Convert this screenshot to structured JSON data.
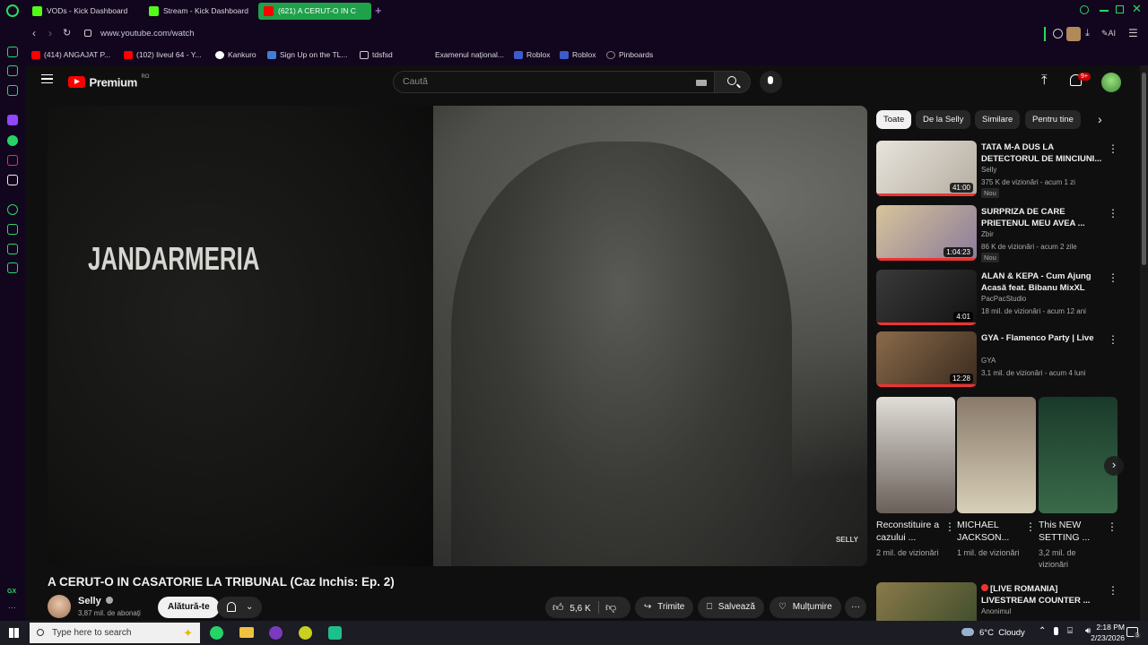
{
  "browser": {
    "tabs": [
      {
        "label": "VODs - Kick Dashboard",
        "color": "#53fc18"
      },
      {
        "label": "Stream - Kick Dashboard",
        "color": "#53fc18"
      },
      {
        "label": "(621) A CERUT-O IN C",
        "color": "#ff0000"
      }
    ],
    "url": "www.youtube.com/watch",
    "ai_label": "AI",
    "bookmarks": [
      {
        "label": "(414) ANGAJAT P...",
        "color": "#ff0000"
      },
      {
        "label": "(102) liveul 64 - Y...",
        "color": "#ff0000"
      },
      {
        "label": "Kankuro",
        "color": "#ffffff"
      },
      {
        "label": "Sign Up on the TL...",
        "color": "#3d7fd6"
      },
      {
        "label": "tdsfsd",
        "color": "#cccccc"
      },
      {
        "label": "Examenul național...",
        "color": "#12061e"
      },
      {
        "label": "Roblox",
        "color": "#3d5ccc"
      },
      {
        "label": "Roblox",
        "color": "#3d5ccc"
      },
      {
        "label": "Pinboards",
        "color": "#888888"
      }
    ],
    "sidebar_gx_label": "GX"
  },
  "youtube": {
    "logo_text": "Premium",
    "logo_region": "RO",
    "search_placeholder": "Caută",
    "notifications_badge": "9+",
    "video": {
      "overlay_text": "JANDARMERIA",
      "watermark": "SELLY",
      "title": "A CERUT-O IN CASATORIE LA TRIBUNAL (Caz Inchis: Ep. 2)"
    },
    "channel": {
      "name": "Selly",
      "subscribers": "3,87 mil. de abonați",
      "join_label": "Alătură-te"
    },
    "actions": {
      "likes": "5,6 K",
      "share": "Trimite",
      "save": "Salvează",
      "thanks": "Mulțumire"
    },
    "chips": [
      "Toate",
      "De la Selly",
      "Similare",
      "Pentru tine"
    ],
    "recommendations": [
      {
        "title": "TATA M-A DUS LA DETECTORUL DE MINCIUNI...",
        "channel": "Selly",
        "meta": "375 K de vizionări - acum 1 zi",
        "badge": "Nou",
        "duration": "41:00",
        "thumb": "#c9c2b8"
      },
      {
        "title": "SURPRIZA DE CARE PRIETENUL MEU AVEA ...",
        "channel": "Zbir",
        "meta": "86 K de vizionări - acum 2 zile",
        "badge": "Nou",
        "duration": "1:04:23",
        "thumb": "#b8a88e"
      },
      {
        "title": "ALAN & KEPA - Cum Ajung Acasă feat. Bibanu MixXL",
        "channel": "PacPacStudio",
        "meta": "18 mil. de vizionări - acum 12 ani",
        "badge": "",
        "duration": "4:01",
        "thumb": "#2a2a2a"
      },
      {
        "title": "GYA - Flamenco Party | Live",
        "channel": "GYA",
        "meta": "3,1 mil. de vizionări - acum 4 luni",
        "badge": "",
        "duration": "12:28",
        "thumb": "#5e4a3a"
      }
    ],
    "shorts": [
      {
        "title": "Reconstituire a cazului ...",
        "views": "2 mil. de vizionări",
        "thumb": "#7a7068"
      },
      {
        "title": "MICHAEL JACKSON...",
        "views": "1 mil. de vizionări",
        "thumb": "#a89a7a"
      },
      {
        "title": "This NEW SETTING ...",
        "views": "3,2 mil. de vizionări",
        "thumb": "#2c4a3a"
      }
    ],
    "live_rec": {
      "title": "[LIVE ROMANIA] LIVESTREAM COUNTER ...",
      "channel": "Anonimul"
    }
  },
  "taskbar": {
    "search_placeholder": "Type here to search",
    "weather": "6°C  Cloudy",
    "time": "2:18 PM",
    "date": "2/23/2026",
    "notification_count": "3"
  }
}
